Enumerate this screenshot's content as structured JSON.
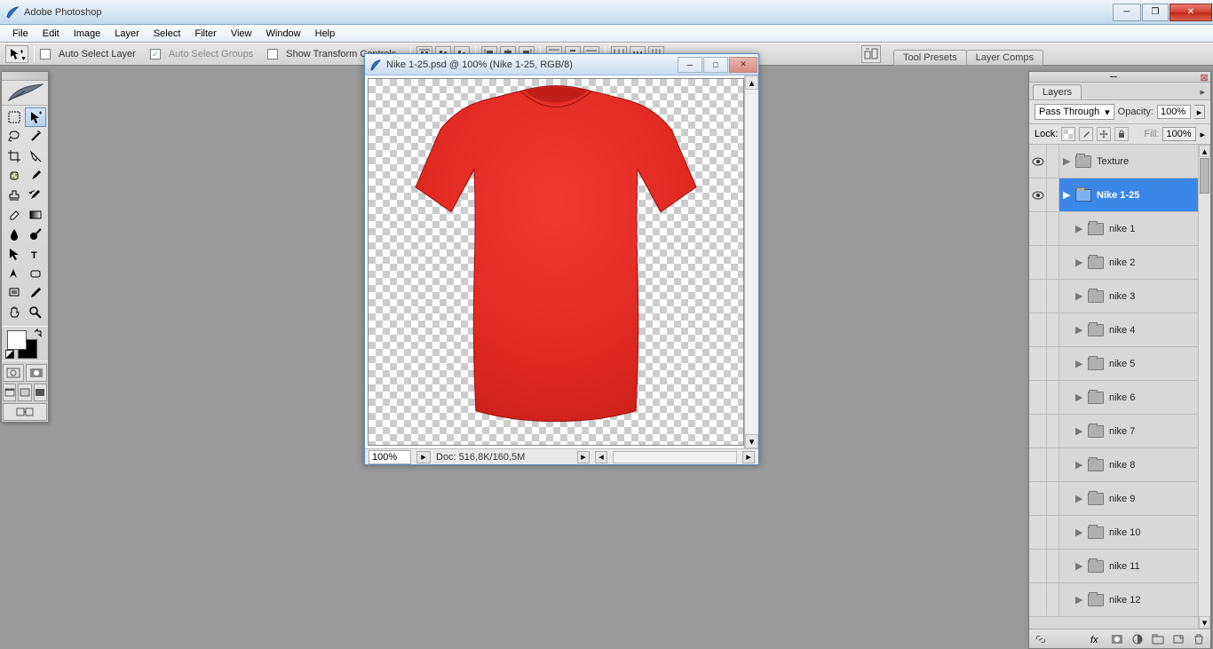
{
  "app": {
    "title": "Adobe Photoshop"
  },
  "menu": [
    "File",
    "Edit",
    "Image",
    "Layer",
    "Select",
    "Filter",
    "View",
    "Window",
    "Help"
  ],
  "options": {
    "auto_select_layer": "Auto Select Layer",
    "auto_select_groups": "Auto Select Groups",
    "show_transform": "Show Transform Controls",
    "tab_tool_presets": "Tool Presets",
    "tab_layer_comps": "Layer Comps"
  },
  "doc": {
    "title": "Nike 1-25.psd @ 100% (Nike 1-25, RGB/8)",
    "zoom": "100%",
    "docsize": "Doc: 516,8K/160,5M"
  },
  "layersPanel": {
    "tab": "Layers",
    "blend": "Pass Through",
    "opacity_label": "Opacity:",
    "opacity": "100%",
    "lock_label": "Lock:",
    "fill_label": "Fill:",
    "fill": "100%",
    "layers": [
      {
        "name": "Texture",
        "visible": true,
        "indent": 0,
        "selected": false
      },
      {
        "name": "Nike 1-25",
        "visible": true,
        "indent": 0,
        "selected": true
      },
      {
        "name": "nike 1",
        "visible": false,
        "indent": 1,
        "selected": false
      },
      {
        "name": "nike 2",
        "visible": false,
        "indent": 1,
        "selected": false
      },
      {
        "name": "nike 3",
        "visible": false,
        "indent": 1,
        "selected": false
      },
      {
        "name": "nike 4",
        "visible": false,
        "indent": 1,
        "selected": false
      },
      {
        "name": "nike 5",
        "visible": false,
        "indent": 1,
        "selected": false
      },
      {
        "name": "nike 6",
        "visible": false,
        "indent": 1,
        "selected": false
      },
      {
        "name": "nike 7",
        "visible": false,
        "indent": 1,
        "selected": false
      },
      {
        "name": "nike 8",
        "visible": false,
        "indent": 1,
        "selected": false
      },
      {
        "name": "nike 9",
        "visible": false,
        "indent": 1,
        "selected": false
      },
      {
        "name": "nike 10",
        "visible": false,
        "indent": 1,
        "selected": false
      },
      {
        "name": "nike 11",
        "visible": false,
        "indent": 1,
        "selected": false
      },
      {
        "name": "nike 12",
        "visible": false,
        "indent": 1,
        "selected": false
      }
    ]
  }
}
